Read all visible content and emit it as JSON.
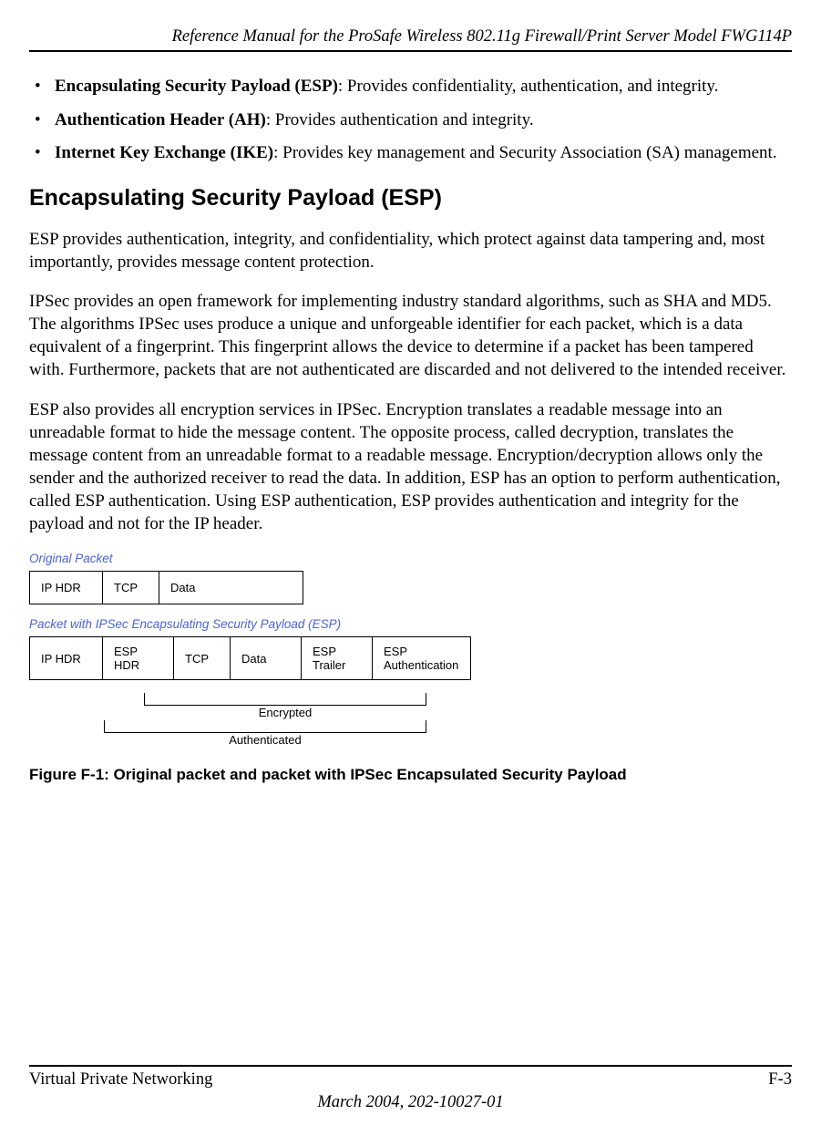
{
  "header": {
    "title": "Reference Manual for the ProSafe Wireless 802.11g  Firewall/Print Server Model FWG114P"
  },
  "bullets": [
    {
      "term": "Encapsulating Security Payload (ESP)",
      "desc": ": Provides confidentiality, authentication, and integrity."
    },
    {
      "term": "Authentication Header (AH)",
      "desc": ": Provides authentication and integrity."
    },
    {
      "term": "Internet Key Exchange (IKE)",
      "desc": ": Provides key management and Security Association (SA) management."
    }
  ],
  "section": {
    "heading": "Encapsulating Security Payload (ESP)",
    "p1": "ESP provides authentication, integrity, and confidentiality, which protect against data tampering and, most importantly, provides message content protection.",
    "p2": "IPSec provides an open framework for implementing industry standard algorithms, such as SHA and MD5. The algorithms IPSec uses produce a unique and unforgeable identifier for each packet, which is a data equivalent of a fingerprint. This fingerprint allows the device to determine if a packet has been tampered with. Furthermore, packets that are not authenticated are discarded and not delivered to the intended receiver.",
    "p3": "ESP also provides all encryption services in IPSec. Encryption translates a readable message into an unreadable format to hide the message content. The opposite process, called decryption, translates the message content from an unreadable format to a readable message. Encryption/decryption allows only the sender and the authorized receiver to read the data. In addition, ESP has an option to perform authentication, called ESP authentication. Using ESP authentication, ESP provides authentication and integrity for the payload and not for the IP header."
  },
  "figure": {
    "label1": "Original Packet",
    "original": {
      "iphdr": "IP HDR",
      "tcp": "TCP",
      "data": "Data"
    },
    "label2": "Packet with IPSec Encapsulating Security Payload (ESP)",
    "esp": {
      "iphdr": "IP HDR",
      "esphdr": "ESP HDR",
      "tcp": "TCP",
      "data": "Data",
      "trailer": "ESP Trailer",
      "auth": "ESP Authentication"
    },
    "encrypted": "Encrypted",
    "authenticated": "Authenticated",
    "caption": "Figure F-1:  Original packet and packet with IPSec Encapsulated Security Payload"
  },
  "footer": {
    "left": "Virtual Private Networking",
    "right": "F-3",
    "date": "March 2004, 202-10027-01"
  }
}
